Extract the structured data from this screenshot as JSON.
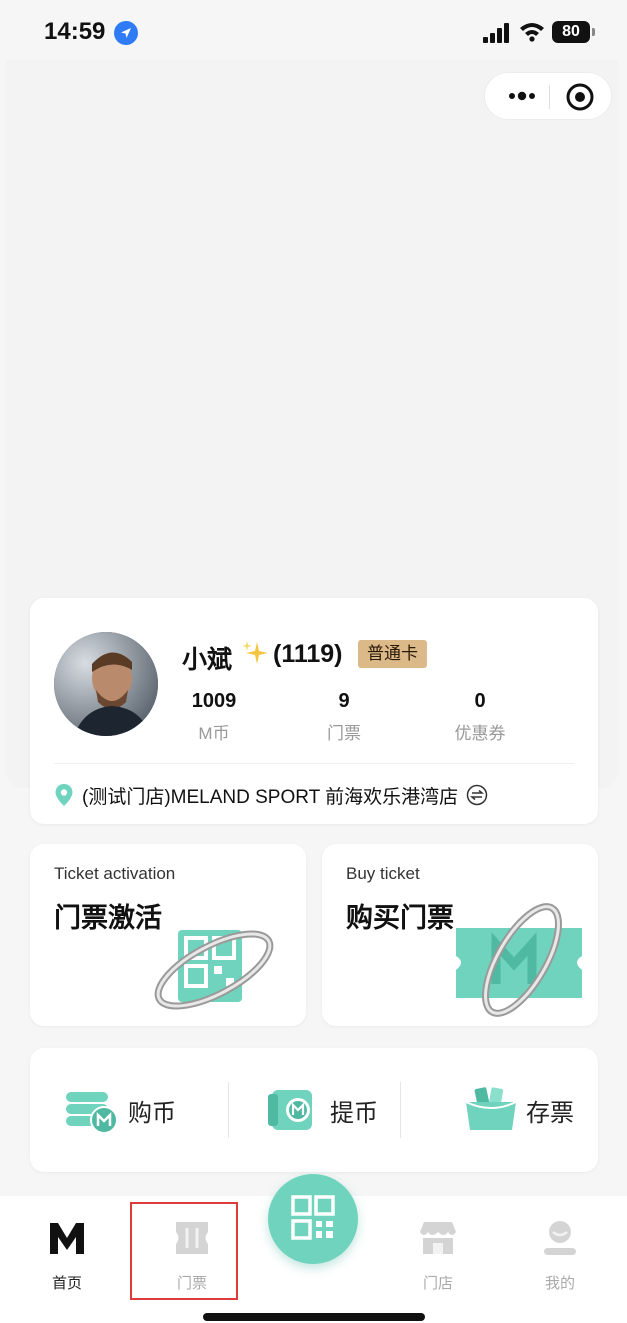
{
  "status_bar": {
    "time": "14:59",
    "battery": "80"
  },
  "profile": {
    "username": "小斌",
    "user_id": "(1119)",
    "member_badge": "普通卡",
    "stats": [
      {
        "value": "1009",
        "label": "M币"
      },
      {
        "value": "9",
        "label": "门票"
      },
      {
        "value": "0",
        "label": "优惠券"
      }
    ],
    "store": "(测试门店)MELAND SPORT 前海欢乐港湾店"
  },
  "actions": {
    "activation": {
      "en": "Ticket activation",
      "cn": "门票激活"
    },
    "buy": {
      "en": "Buy ticket",
      "cn": "购买门票"
    }
  },
  "quick": {
    "buy_coin": "购币",
    "withdraw_coin": "提币",
    "store_ticket": "存票"
  },
  "tabbar": {
    "home": "首页",
    "tickets": "门票",
    "stores": "门店",
    "mine": "我的"
  },
  "colors": {
    "accent": "#6fd3bd",
    "badge": "#dcb989",
    "highlight": "#e03b3b"
  }
}
